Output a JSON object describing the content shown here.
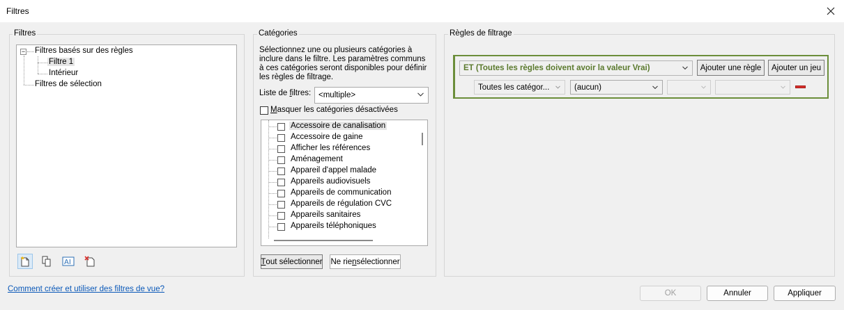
{
  "window": {
    "title": "Filtres",
    "close_glyph": "✕"
  },
  "filters_panel": {
    "title": "Filtres",
    "tree": {
      "rule_based": "Filtres basés sur des règles",
      "filter1": "Filtre 1",
      "interior": "Intérieur",
      "selection": "Filtres de sélection",
      "collapse_glyph": "−"
    },
    "toolbar": [
      "new-filter-icon",
      "duplicate-filter-icon",
      "rename-filter-icon",
      "delete-filter-icon"
    ]
  },
  "categories_panel": {
    "title": "Catégories",
    "description": "Sélectionnez une ou plusieurs catégories à inclure dans le filtre. Les paramètres communs à ces catégories seront disponibles pour définir les règles de filtrage.",
    "filter_list_label_pre": "Liste de ",
    "filter_list_label_ul": "f",
    "filter_list_label_post": "iltres:",
    "filter_list_value": "<multiple>",
    "hide_label_ul": "M",
    "hide_label_rest": "asquer les catégories désactivées",
    "items": [
      "Accessoire de canalisation",
      "Accessoire de gaine",
      "Afficher les références",
      "Aménagement",
      "Appareil d'appel malade",
      "Appareils audiovisuels",
      "Appareils de communication",
      "Appareils de régulation CVC",
      "Appareils sanitaires",
      "Appareils téléphoniques"
    ],
    "select_all_ul": "T",
    "select_all_rest": "out sélectionner",
    "select_none_pre": "Ne rie",
    "select_none_ul": "n",
    "select_none_post": " sélectionner"
  },
  "rules_panel": {
    "title": "Règles de filtrage",
    "logic_value": "ET (Toutes les règles doivent avoir la valeur Vrai)",
    "add_rule": "Ajouter une règle",
    "add_set": "Ajouter un jeu",
    "category_value": "Toutes les catégor...",
    "param_value": "(aucun)"
  },
  "footer": {
    "help_link": "Comment créer et utiliser des filtres de vue?",
    "ok": "OK",
    "cancel": "Annuler",
    "apply": "Appliquer"
  },
  "colors": {
    "accent_green": "#6b8e3a",
    "logic_text": "#5b7a2e",
    "delete_red": "#d9302c",
    "link": "#0a58b8"
  }
}
